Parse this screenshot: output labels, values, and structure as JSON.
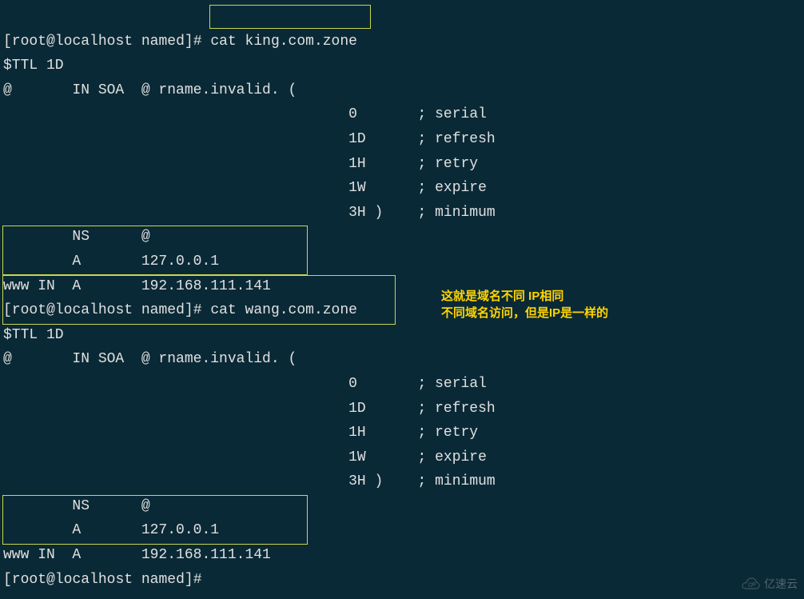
{
  "prompt1": {
    "user": "root",
    "host": "localhost",
    "cwd": "named",
    "symbol": "#",
    "command": "cat king.com.zone"
  },
  "zone1": {
    "ttl": "$TTL 1D",
    "soa": "@       IN SOA  @ rname.invalid. (",
    "params": [
      {
        "val": "0",
        "comment": "; serial"
      },
      {
        "val": "1D",
        "comment": "; refresh"
      },
      {
        "val": "1H",
        "comment": "; retry"
      },
      {
        "val": "1W",
        "comment": "; expire"
      },
      {
        "val": "3H )",
        "comment": "; minimum"
      }
    ],
    "ns": "        NS      @",
    "a1": "        A       127.0.0.1",
    "a2": "www IN  A       192.168.111.141"
  },
  "prompt2": {
    "user": "root",
    "host": "localhost",
    "cwd": "named",
    "symbol": "#",
    "command": "cat wang.com.zone"
  },
  "zone2": {
    "ttl": "$TTL 1D",
    "soa": "@       IN SOA  @ rname.invalid. (",
    "params": [
      {
        "val": "0",
        "comment": "; serial"
      },
      {
        "val": "1D",
        "comment": "; refresh"
      },
      {
        "val": "1H",
        "comment": "; retry"
      },
      {
        "val": "1W",
        "comment": "; expire"
      },
      {
        "val": "3H )",
        "comment": "; minimum"
      }
    ],
    "ns": "        NS      @",
    "a1": "        A       127.0.0.1",
    "a2": "www IN  A       192.168.111.141"
  },
  "prompt3": {
    "user": "root",
    "host": "localhost",
    "cwd": "named",
    "symbol": "#",
    "command": ""
  },
  "annotation": {
    "line1": "这就是域名不同 IP相同",
    "line2": "不同域名访问，但是IP是一样的"
  },
  "watermark": "亿速云"
}
